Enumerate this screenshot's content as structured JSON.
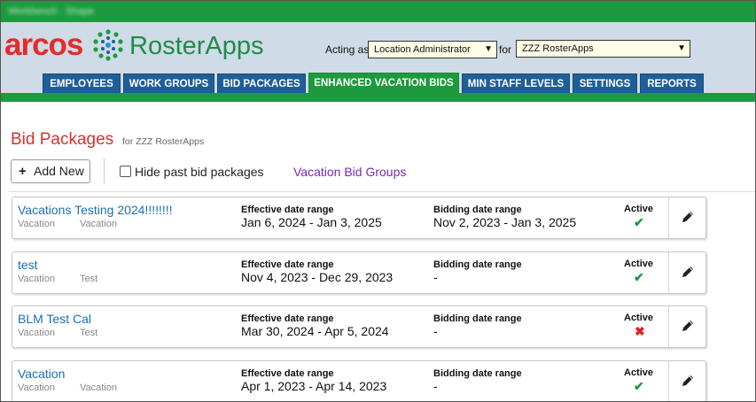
{
  "topbar": {
    "blurred_text": "Workbench · Shape"
  },
  "brand": {
    "arcos": "arcos",
    "product": "RosterApps",
    "colors": {
      "red": "#e52b2b",
      "green": "#1e9a3e",
      "blue": "#1f5f99"
    }
  },
  "header": {
    "acting_label": "Acting as",
    "role_value": "Location Administrator",
    "for_label": "for",
    "location_value": "ZZZ RosterApps"
  },
  "tabs": [
    {
      "label": "EMPLOYEES"
    },
    {
      "label": "WORK GROUPS"
    },
    {
      "label": "BID PACKAGES"
    },
    {
      "label": "ENHANCED VACATION BIDS",
      "active": true
    },
    {
      "label": "MIN STAFF LEVELS"
    },
    {
      "label": "SETTINGS"
    },
    {
      "label": "REPORTS"
    }
  ],
  "page": {
    "title": "Bid Packages",
    "subtitle": "for ZZZ RosterApps",
    "add_label": "Add New",
    "hide_past_label": "Hide past bid packages",
    "vacation_groups_link": "Vacation Bid Groups"
  },
  "columns": {
    "effective": "Effective date range",
    "bidding": "Bidding date range",
    "active": "Active"
  },
  "packages": [
    {
      "name": "Vacations Testing 2024!!!!!!!!",
      "type": "Vacation",
      "category": "Vacation",
      "effective": "Jan 6, 2024 - Jan 3, 2025",
      "bidding": "Nov 2, 2023 - Jan 3, 2025",
      "active": true,
      "active_icon": "check-icon"
    },
    {
      "name": "test",
      "type": "Vacation",
      "category": "Test",
      "effective": "Nov 4, 2023 - Dec 29, 2023",
      "bidding": "-",
      "active": true,
      "active_icon": "check-icon"
    },
    {
      "name": "BLM Test Cal",
      "type": "Vacation",
      "category": "Test",
      "effective": "Mar 30, 2024 - Apr 5, 2024",
      "bidding": "-",
      "active": false,
      "active_icon": "x-icon"
    },
    {
      "name": "Vacation",
      "type": "Vacation",
      "category": "Vacation",
      "effective": "Apr 1, 2023 - Apr 14, 2023",
      "bidding": "-",
      "active": true,
      "active_icon": "check-icon"
    }
  ]
}
